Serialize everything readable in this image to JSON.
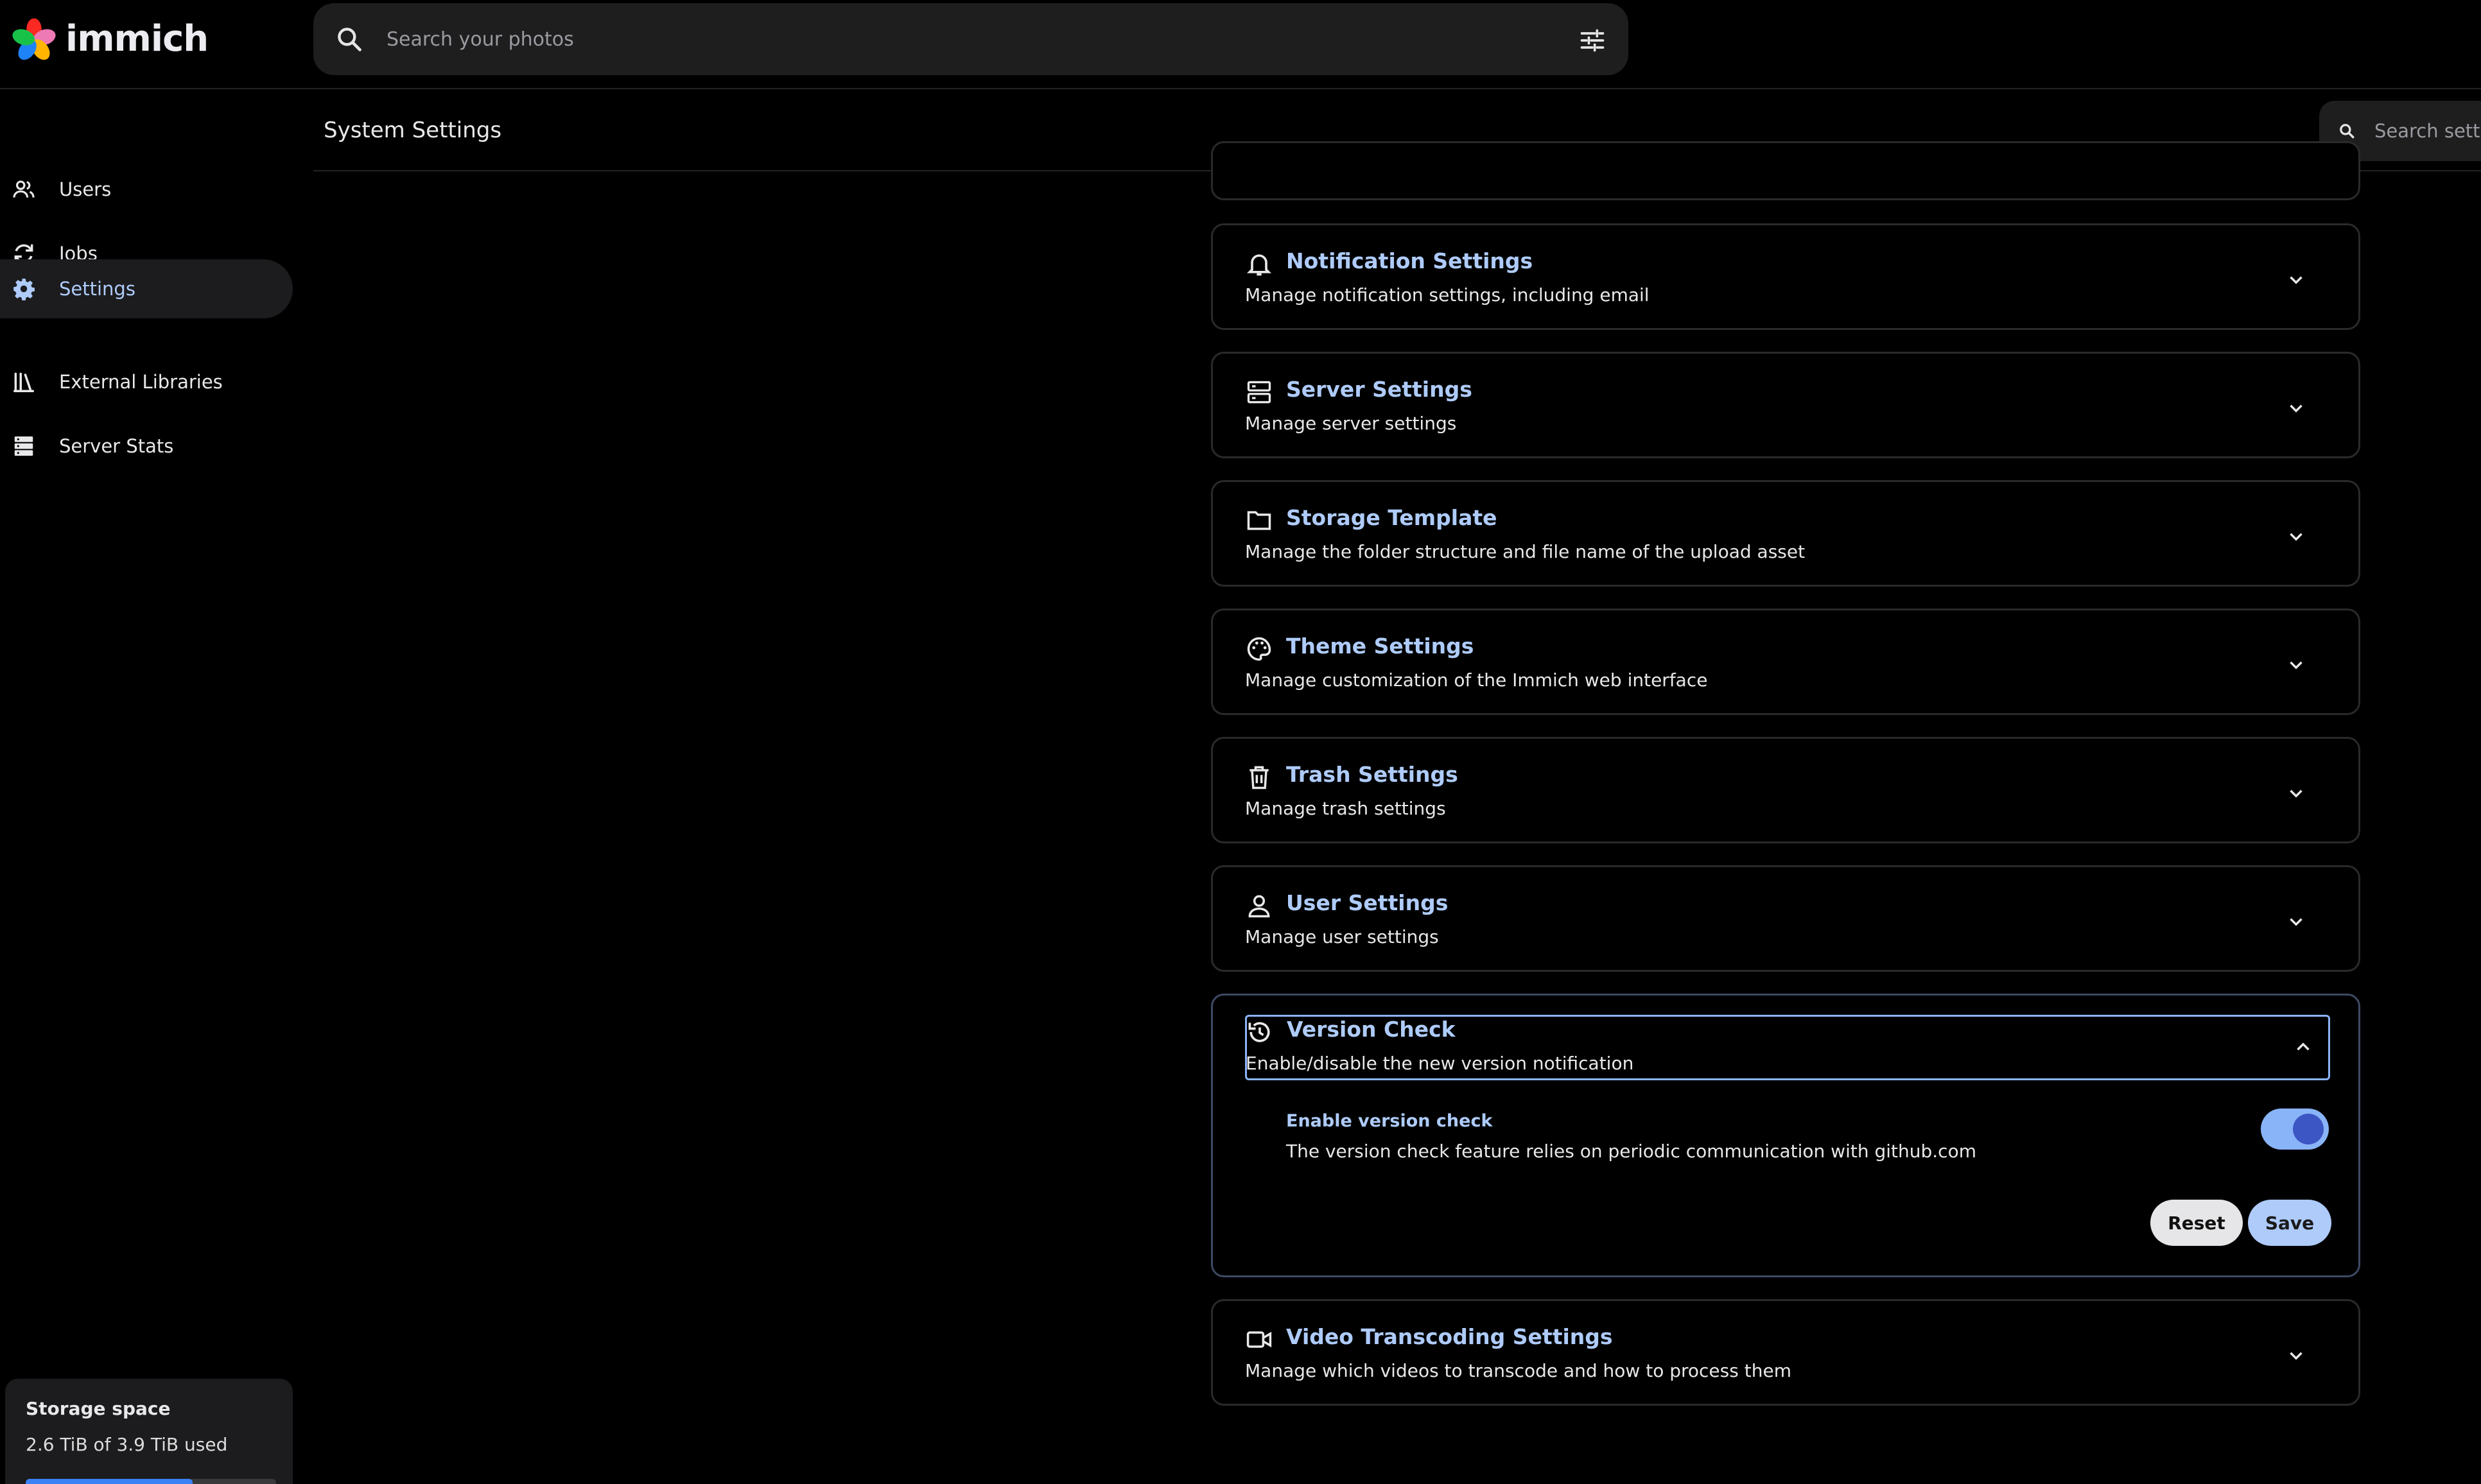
{
  "app": {
    "name": "immich"
  },
  "search": {
    "placeholder": "Search your photos"
  },
  "sidebar": {
    "items": [
      {
        "label": "Users",
        "icon": "users-icon"
      },
      {
        "label": "Jobs",
        "icon": "sync-icon"
      },
      {
        "label": "Settings",
        "icon": "gear-icon",
        "active": true
      },
      {
        "label": "External Libraries",
        "icon": "library-icon"
      },
      {
        "label": "Server Stats",
        "icon": "server-icon"
      }
    ],
    "storage": {
      "title": "Storage space",
      "used_text": "2.6 TiB of 3.9 TiB used",
      "used_fraction": 0.667
    }
  },
  "header": {
    "title": "System Settings",
    "search_placeholder": "Search settings"
  },
  "settings": [
    {
      "title": "Notification Settings",
      "desc": "Manage notification settings, including email",
      "icon": "bell-icon"
    },
    {
      "title": "Server Settings",
      "desc": "Manage server settings",
      "icon": "server-icon"
    },
    {
      "title": "Storage Template",
      "desc": "Manage the folder structure and file name of the upload asset",
      "icon": "folder-icon"
    },
    {
      "title": "Theme Settings",
      "desc": "Manage customization of the Immich web interface",
      "icon": "palette-icon"
    },
    {
      "title": "Trash Settings",
      "desc": "Manage trash settings",
      "icon": "trash-icon"
    },
    {
      "title": "User Settings",
      "desc": "Manage user settings",
      "icon": "user-icon"
    },
    {
      "title": "Version Check",
      "desc": "Enable/disable the new version notification",
      "icon": "history-icon",
      "expanded": true,
      "option": {
        "title": "Enable version check",
        "desc": "The version check feature relies on periodic communication with github.com",
        "enabled": true
      },
      "reset_label": "Reset",
      "save_label": "Save"
    },
    {
      "title": "Video Transcoding Settings",
      "desc": "Manage which videos to transcode and how to process them",
      "icon": "video-icon"
    }
  ],
  "colors": {
    "accent": "#aecbfa",
    "background": "#000000",
    "panel_border": "#2a2a2d",
    "toggle_knob": "#3c56c4"
  }
}
